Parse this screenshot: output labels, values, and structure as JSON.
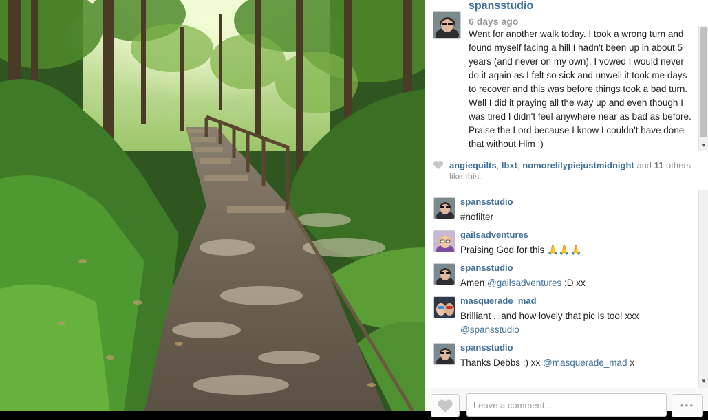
{
  "post": {
    "username": "spansstudio",
    "time_ago": "6 days ago",
    "caption": "Went for another walk today. I took a wrong turn and found myself facing a hill I hadn't been up in about 5 years (and never on my own). I vowed I would never do it again as I felt so sick and unwell it took me days to recover and this was before things took a bad turn. Well I did it praying all the way up and even though I was tired I didn't feel anywhere near as bad as before. Praise the Lord because I know I couldn't have done that without Him :)"
  },
  "likes": {
    "users": [
      "angiequilts",
      "lbxt",
      "nomorelilypiejustmidnight"
    ],
    "sep1": ", ",
    "sep2": ", ",
    "and_text": " and ",
    "others_count": "11",
    "others_text": " others like this."
  },
  "comments": [
    {
      "username": "spansstudio",
      "text": "#nofilter",
      "mention": "",
      "suffix": ""
    },
    {
      "username": "gailsadventures",
      "text": "Praising God for this 🙏🙏🙏",
      "mention": "",
      "suffix": ""
    },
    {
      "username": "spansstudio",
      "text": "Amen ",
      "mention": "@gailsadventures",
      "suffix": " :D xx"
    },
    {
      "username": "masquerade_mad",
      "text": "Brilliant ...and how lovely that pic is too! xxx ",
      "mention": "@spansstudio",
      "suffix": ""
    },
    {
      "username": "spansstudio",
      "text": "Thanks Debbs :) xx ",
      "mention": "@masquerade_mad",
      "suffix": " x"
    }
  ],
  "footer": {
    "comment_placeholder": "Leave a comment...",
    "more_label": "●●●"
  },
  "icons": {
    "like": "heart-icon",
    "more": "more-options-icon"
  },
  "colors": {
    "username": "#3f729b",
    "muted": "#999999"
  }
}
